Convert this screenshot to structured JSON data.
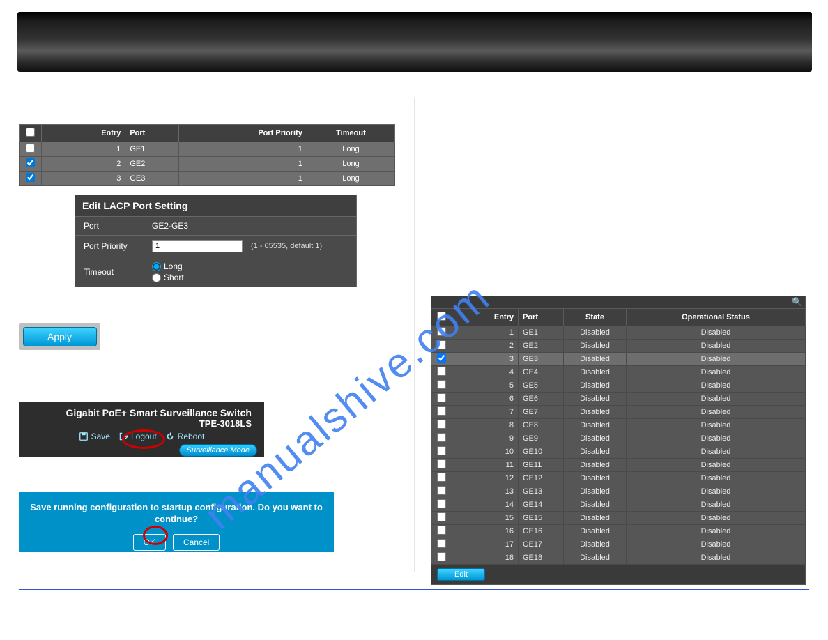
{
  "left": {
    "table1": {
      "headers": {
        "entry": "Entry",
        "port": "Port",
        "priority": "Port Priority",
        "timeout": "Timeout"
      },
      "rows": [
        {
          "checked": false,
          "entry": "1",
          "port": "GE1",
          "priority": "1",
          "timeout": "Long"
        },
        {
          "checked": true,
          "entry": "2",
          "port": "GE2",
          "priority": "1",
          "timeout": "Long"
        },
        {
          "checked": true,
          "entry": "3",
          "port": "GE3",
          "priority": "1",
          "timeout": "Long"
        }
      ]
    },
    "edit_panel": {
      "title": "Edit LACP Port Setting",
      "port_label": "Port",
      "port_value": "GE2-GE3",
      "priority_label": "Port Priority",
      "priority_value": "1",
      "priority_hint": "(1 - 65535, default 1)",
      "timeout_label": "Timeout",
      "timeout_long": "Long",
      "timeout_short": "Short"
    },
    "apply_label": "Apply",
    "device_bar": {
      "title": "Gigabit PoE+ Smart Surveillance Switch",
      "model": "TPE-3018LS",
      "save": "Save",
      "logout": "Logout",
      "reboot": "Reboot",
      "surv_mode": "Surveillance Mode"
    },
    "dialog": {
      "message": "Save running configuration to startup configuration. Do you want to continue?",
      "ok": "OK",
      "cancel": "Cancel"
    }
  },
  "right": {
    "table2": {
      "headers": {
        "entry": "Entry",
        "port": "Port",
        "state": "State",
        "op": "Operational Status"
      },
      "rows": [
        {
          "checked": false,
          "entry": "1",
          "port": "GE1",
          "state": "Disabled",
          "op": "Disabled"
        },
        {
          "checked": false,
          "entry": "2",
          "port": "GE2",
          "state": "Disabled",
          "op": "Disabled"
        },
        {
          "checked": true,
          "entry": "3",
          "port": "GE3",
          "state": "Disabled",
          "op": "Disabled"
        },
        {
          "checked": false,
          "entry": "4",
          "port": "GE4",
          "state": "Disabled",
          "op": "Disabled"
        },
        {
          "checked": false,
          "entry": "5",
          "port": "GE5",
          "state": "Disabled",
          "op": "Disabled"
        },
        {
          "checked": false,
          "entry": "6",
          "port": "GE6",
          "state": "Disabled",
          "op": "Disabled"
        },
        {
          "checked": false,
          "entry": "7",
          "port": "GE7",
          "state": "Disabled",
          "op": "Disabled"
        },
        {
          "checked": false,
          "entry": "8",
          "port": "GE8",
          "state": "Disabled",
          "op": "Disabled"
        },
        {
          "checked": false,
          "entry": "9",
          "port": "GE9",
          "state": "Disabled",
          "op": "Disabled"
        },
        {
          "checked": false,
          "entry": "10",
          "port": "GE10",
          "state": "Disabled",
          "op": "Disabled"
        },
        {
          "checked": false,
          "entry": "11",
          "port": "GE11",
          "state": "Disabled",
          "op": "Disabled"
        },
        {
          "checked": false,
          "entry": "12",
          "port": "GE12",
          "state": "Disabled",
          "op": "Disabled"
        },
        {
          "checked": false,
          "entry": "13",
          "port": "GE13",
          "state": "Disabled",
          "op": "Disabled"
        },
        {
          "checked": false,
          "entry": "14",
          "port": "GE14",
          "state": "Disabled",
          "op": "Disabled"
        },
        {
          "checked": false,
          "entry": "15",
          "port": "GE15",
          "state": "Disabled",
          "op": "Disabled"
        },
        {
          "checked": false,
          "entry": "16",
          "port": "GE16",
          "state": "Disabled",
          "op": "Disabled"
        },
        {
          "checked": false,
          "entry": "17",
          "port": "GE17",
          "state": "Disabled",
          "op": "Disabled"
        },
        {
          "checked": false,
          "entry": "18",
          "port": "GE18",
          "state": "Disabled",
          "op": "Disabled"
        }
      ],
      "edit_label": "Edit"
    }
  },
  "watermark": "manualshive.com"
}
